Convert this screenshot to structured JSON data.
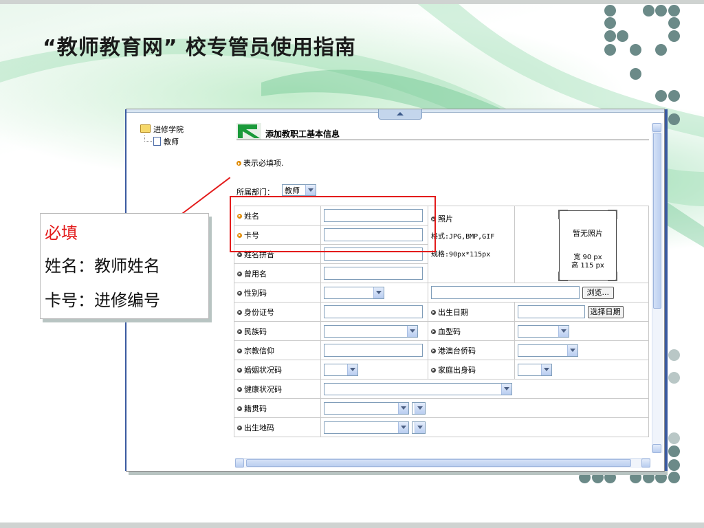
{
  "slide": {
    "title": "“教师教育网” 校专管员使用指南"
  },
  "tree": {
    "root": "进修学院",
    "child": "教师"
  },
  "form_page": {
    "header": "添加教职工基本信息",
    "required_note": "表示必填项.",
    "dept_label": "所属部门：",
    "dept_value": "教师"
  },
  "fields": {
    "name": "姓名",
    "card": "卡号",
    "name_pinyin": "姓名拼音",
    "former_name": "曾用名",
    "gender": "性别码",
    "id_number": "身份证号",
    "ethnicity": "民族码",
    "religion": "宗教信仰",
    "marital": "婚姻状况码",
    "health": "健康状况码",
    "native_place": "籍贯码",
    "birthplace": "出生地码",
    "photo": "照片",
    "photo_format": "格式:JPG,BMP,GIF",
    "photo_spec": "规格:90px*115px",
    "birth_date": "出生日期",
    "blood_type": "血型码",
    "hk_macau_tw": "港澳台侨码",
    "family_origin": "家庭出身码"
  },
  "photo_placeholder": {
    "no_photo": "暂无照片",
    "width": "宽  90 px",
    "height": "高 115 px"
  },
  "buttons": {
    "browse": "浏览...",
    "choose_date": "选择日期"
  },
  "callout": {
    "required": "必填",
    "name_hint": "姓名：教师姓名",
    "card_hint": "卡号：进修编号"
  },
  "colors": {
    "annotation_red": "#e31b1b",
    "dot_color": "#6b8a88"
  }
}
